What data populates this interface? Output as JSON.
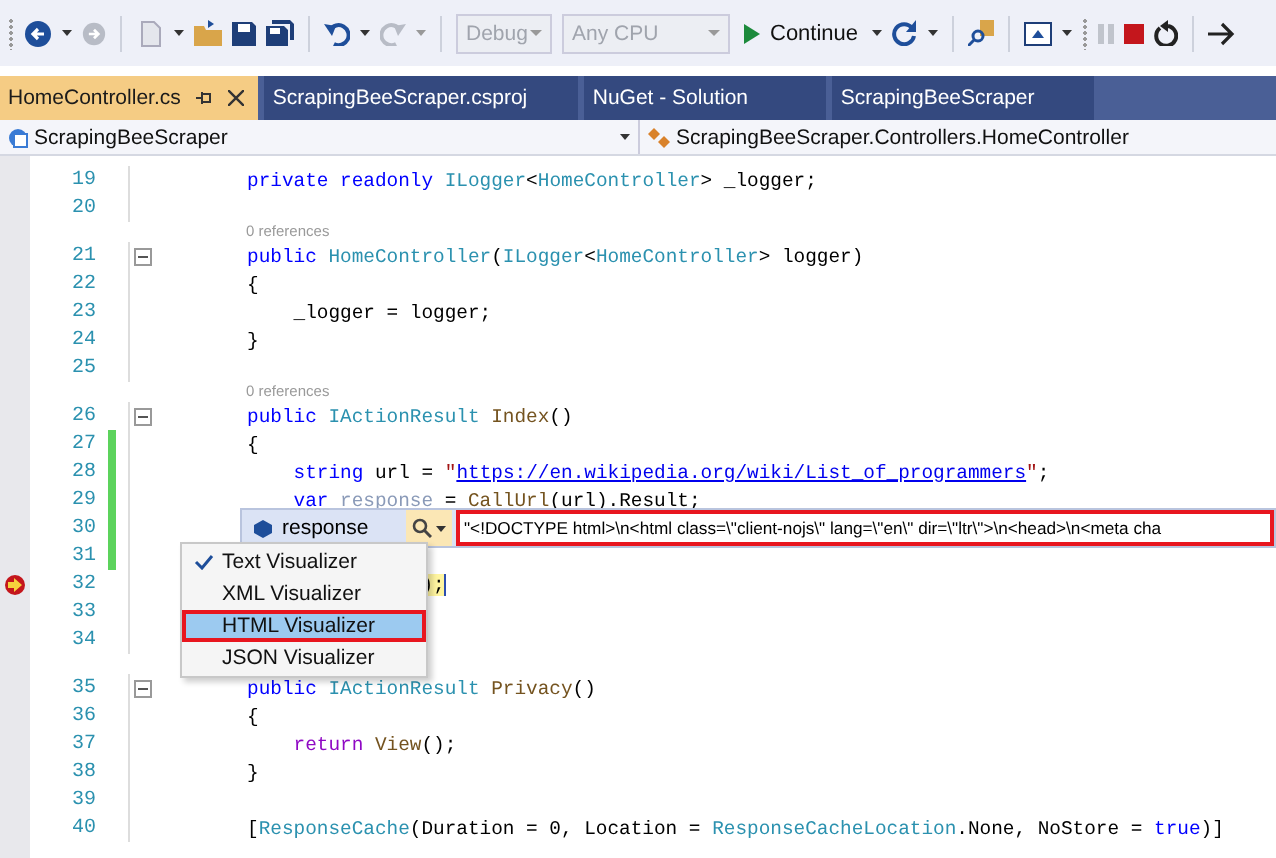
{
  "toolbar": {
    "configuration": {
      "value": "Debug",
      "disabled": true
    },
    "platform": {
      "value": "Any CPU",
      "disabled": true
    },
    "continue_button": {
      "label": "Continue"
    }
  },
  "tabs": [
    {
      "label": "HomeController.cs",
      "selected": true
    },
    {
      "label": "ScrapingBeeScraper.csproj",
      "selected": false
    },
    {
      "label": "NuGet - Solution",
      "selected": false
    },
    {
      "label": "ScrapingBeeScraper",
      "selected": false
    }
  ],
  "navigation_bar": {
    "project": "ScrapingBeeScraper",
    "member": "ScrapingBeeScraper.Controllers.HomeController"
  },
  "editor": {
    "lines": [
      {
        "number": "19",
        "code": [
          {
            "kind": "kw",
            "text": "        private readonly "
          },
          {
            "kind": "type",
            "text": "ILogger"
          },
          {
            "kind": "plain",
            "text": "<"
          },
          {
            "kind": "type",
            "text": "HomeController"
          },
          {
            "kind": "plain",
            "text": "> _logger;"
          }
        ]
      },
      {
        "number": "20"
      },
      {
        "number": "21",
        "lens": "0 references",
        "collapsible": true,
        "code": [
          {
            "kind": "kw",
            "text": "        public "
          },
          {
            "kind": "type",
            "text": "HomeController"
          },
          {
            "kind": "plain",
            "text": "("
          },
          {
            "kind": "type",
            "text": "ILogger"
          },
          {
            "kind": "plain",
            "text": "<"
          },
          {
            "kind": "type",
            "text": "HomeController"
          },
          {
            "kind": "plain",
            "text": "> logger)"
          }
        ]
      },
      {
        "number": "22",
        "code": [
          {
            "kind": "plain",
            "text": "        {"
          }
        ]
      },
      {
        "number": "23",
        "code": [
          {
            "kind": "plain",
            "text": "            _logger = logger;"
          }
        ]
      },
      {
        "number": "24",
        "code": [
          {
            "kind": "plain",
            "text": "        }"
          }
        ]
      },
      {
        "number": "25"
      },
      {
        "number": "26",
        "lens": "0 references",
        "collapsible": true,
        "code": [
          {
            "kind": "kw",
            "text": "        public "
          },
          {
            "kind": "type",
            "text": "IActionResult "
          },
          {
            "kind": "method",
            "text": "Index"
          },
          {
            "kind": "plain",
            "text": "()"
          }
        ]
      },
      {
        "number": "27",
        "changed": true,
        "code": [
          {
            "kind": "plain",
            "text": "        {"
          }
        ]
      },
      {
        "number": "28",
        "changed": true,
        "code": [
          {
            "kind": "kw",
            "text": "            string "
          },
          {
            "kind": "plain",
            "text": "url = "
          },
          {
            "kind": "str",
            "text": "\""
          },
          {
            "kind": "link",
            "text": "https://en.wikipedia.org/wiki/List_of_programmers"
          },
          {
            "kind": "str",
            "text": "\""
          },
          {
            "kind": "plain",
            "text": ";"
          }
        ]
      },
      {
        "number": "29",
        "changed": true,
        "code": [
          {
            "kind": "kw",
            "text": "            var "
          },
          {
            "kind": "faded",
            "text": "response"
          },
          {
            "kind": "plain",
            "text": " = "
          },
          {
            "kind": "method",
            "text": "CallUrl"
          },
          {
            "kind": "plain",
            "text": "(url).Result;"
          }
        ]
      },
      {
        "number": "30",
        "changed": true
      },
      {
        "number": "31",
        "changed": true
      },
      {
        "number": "32",
        "current": true,
        "code": [
          {
            "kind": "plain",
            "text": "                       );"
          }
        ]
      },
      {
        "number": "33"
      },
      {
        "number": "34"
      },
      {
        "number": "35",
        "collapsible": true,
        "code": [
          {
            "kind": "kw",
            "text": "        public "
          },
          {
            "kind": "type",
            "text": "IActionResult "
          },
          {
            "kind": "method",
            "text": "Privacy"
          },
          {
            "kind": "plain",
            "text": "()"
          }
        ]
      },
      {
        "number": "36",
        "code": [
          {
            "kind": "plain",
            "text": "        {"
          }
        ]
      },
      {
        "number": "37",
        "code": [
          {
            "kind": "ctrl",
            "text": "            return "
          },
          {
            "kind": "method",
            "text": "View"
          },
          {
            "kind": "plain",
            "text": "();"
          }
        ]
      },
      {
        "number": "38",
        "code": [
          {
            "kind": "plain",
            "text": "        }"
          }
        ]
      },
      {
        "number": "39"
      },
      {
        "number": "40",
        "code": [
          {
            "kind": "plain",
            "text": "        ["
          },
          {
            "kind": "type",
            "text": "ResponseCache"
          },
          {
            "kind": "plain",
            "text": "(Duration = 0, Location = "
          },
          {
            "kind": "type",
            "text": "ResponseCacheLocation"
          },
          {
            "kind": "plain",
            "text": ".None, NoStore = "
          },
          {
            "kind": "kw",
            "text": "true"
          },
          {
            "kind": "plain",
            "text": ")]"
          }
        ]
      }
    ]
  },
  "data_tip": {
    "name": "response",
    "value": "\"<!DOCTYPE html>\\n<html class=\\\"client-nojs\\\" lang=\\\"en\\\" dir=\\\"ltr\\\">\\n<head>\\n<meta cha",
    "outlined": true
  },
  "visualizer_menu": [
    {
      "label": "Text Visualizer",
      "checked": true,
      "selected": false
    },
    {
      "label": "XML Visualizer",
      "checked": false,
      "selected": false
    },
    {
      "label": "HTML Visualizer",
      "checked": false,
      "selected": true,
      "outlined": true
    },
    {
      "label": "JSON Visualizer",
      "checked": false,
      "selected": false
    }
  ]
}
